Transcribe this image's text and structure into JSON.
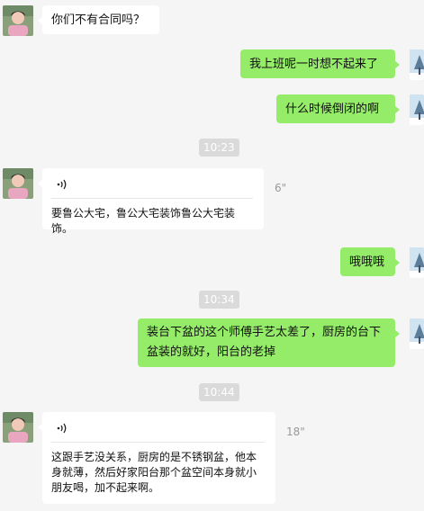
{
  "messages": [
    {
      "side": "in",
      "text": "你们不有合同吗？"
    },
    {
      "side": "out",
      "text": "我上班呢一时想不起来了"
    },
    {
      "side": "out",
      "text": "什么时候倒闭的啊"
    },
    {
      "side": "time",
      "text": "10:23"
    },
    {
      "side": "in",
      "type": "voice",
      "duration": "6\"",
      "transcript": "要鲁公大宅，鲁公大宅装饰鲁公大宅装饰。"
    },
    {
      "side": "out",
      "text": "哦哦哦"
    },
    {
      "side": "time",
      "text": "10:34"
    },
    {
      "side": "out",
      "text": "装台下盆的这个师傅手艺太差了，厨房的台下盆装的就好，阳台的老掉"
    },
    {
      "side": "time",
      "text": "10:44"
    },
    {
      "side": "in",
      "type": "voice",
      "duration": "18\"",
      "transcript": "这跟手艺没关系，厨房的是不锈钢盆，他本身就薄，然后好家阳台那个盆空间本身就小朋友喝，加不起来啊。"
    }
  ],
  "colors": {
    "outgoing_bubble": "#95ec69",
    "incoming_bubble": "#ffffff",
    "background": "#f5f5f5",
    "timestamp_bg": "#dadada"
  },
  "icons": {
    "voice": "voice-wave-icon",
    "self_avatar": "winter-tree-avatar",
    "contact_avatar": "person-photo-avatar"
  }
}
